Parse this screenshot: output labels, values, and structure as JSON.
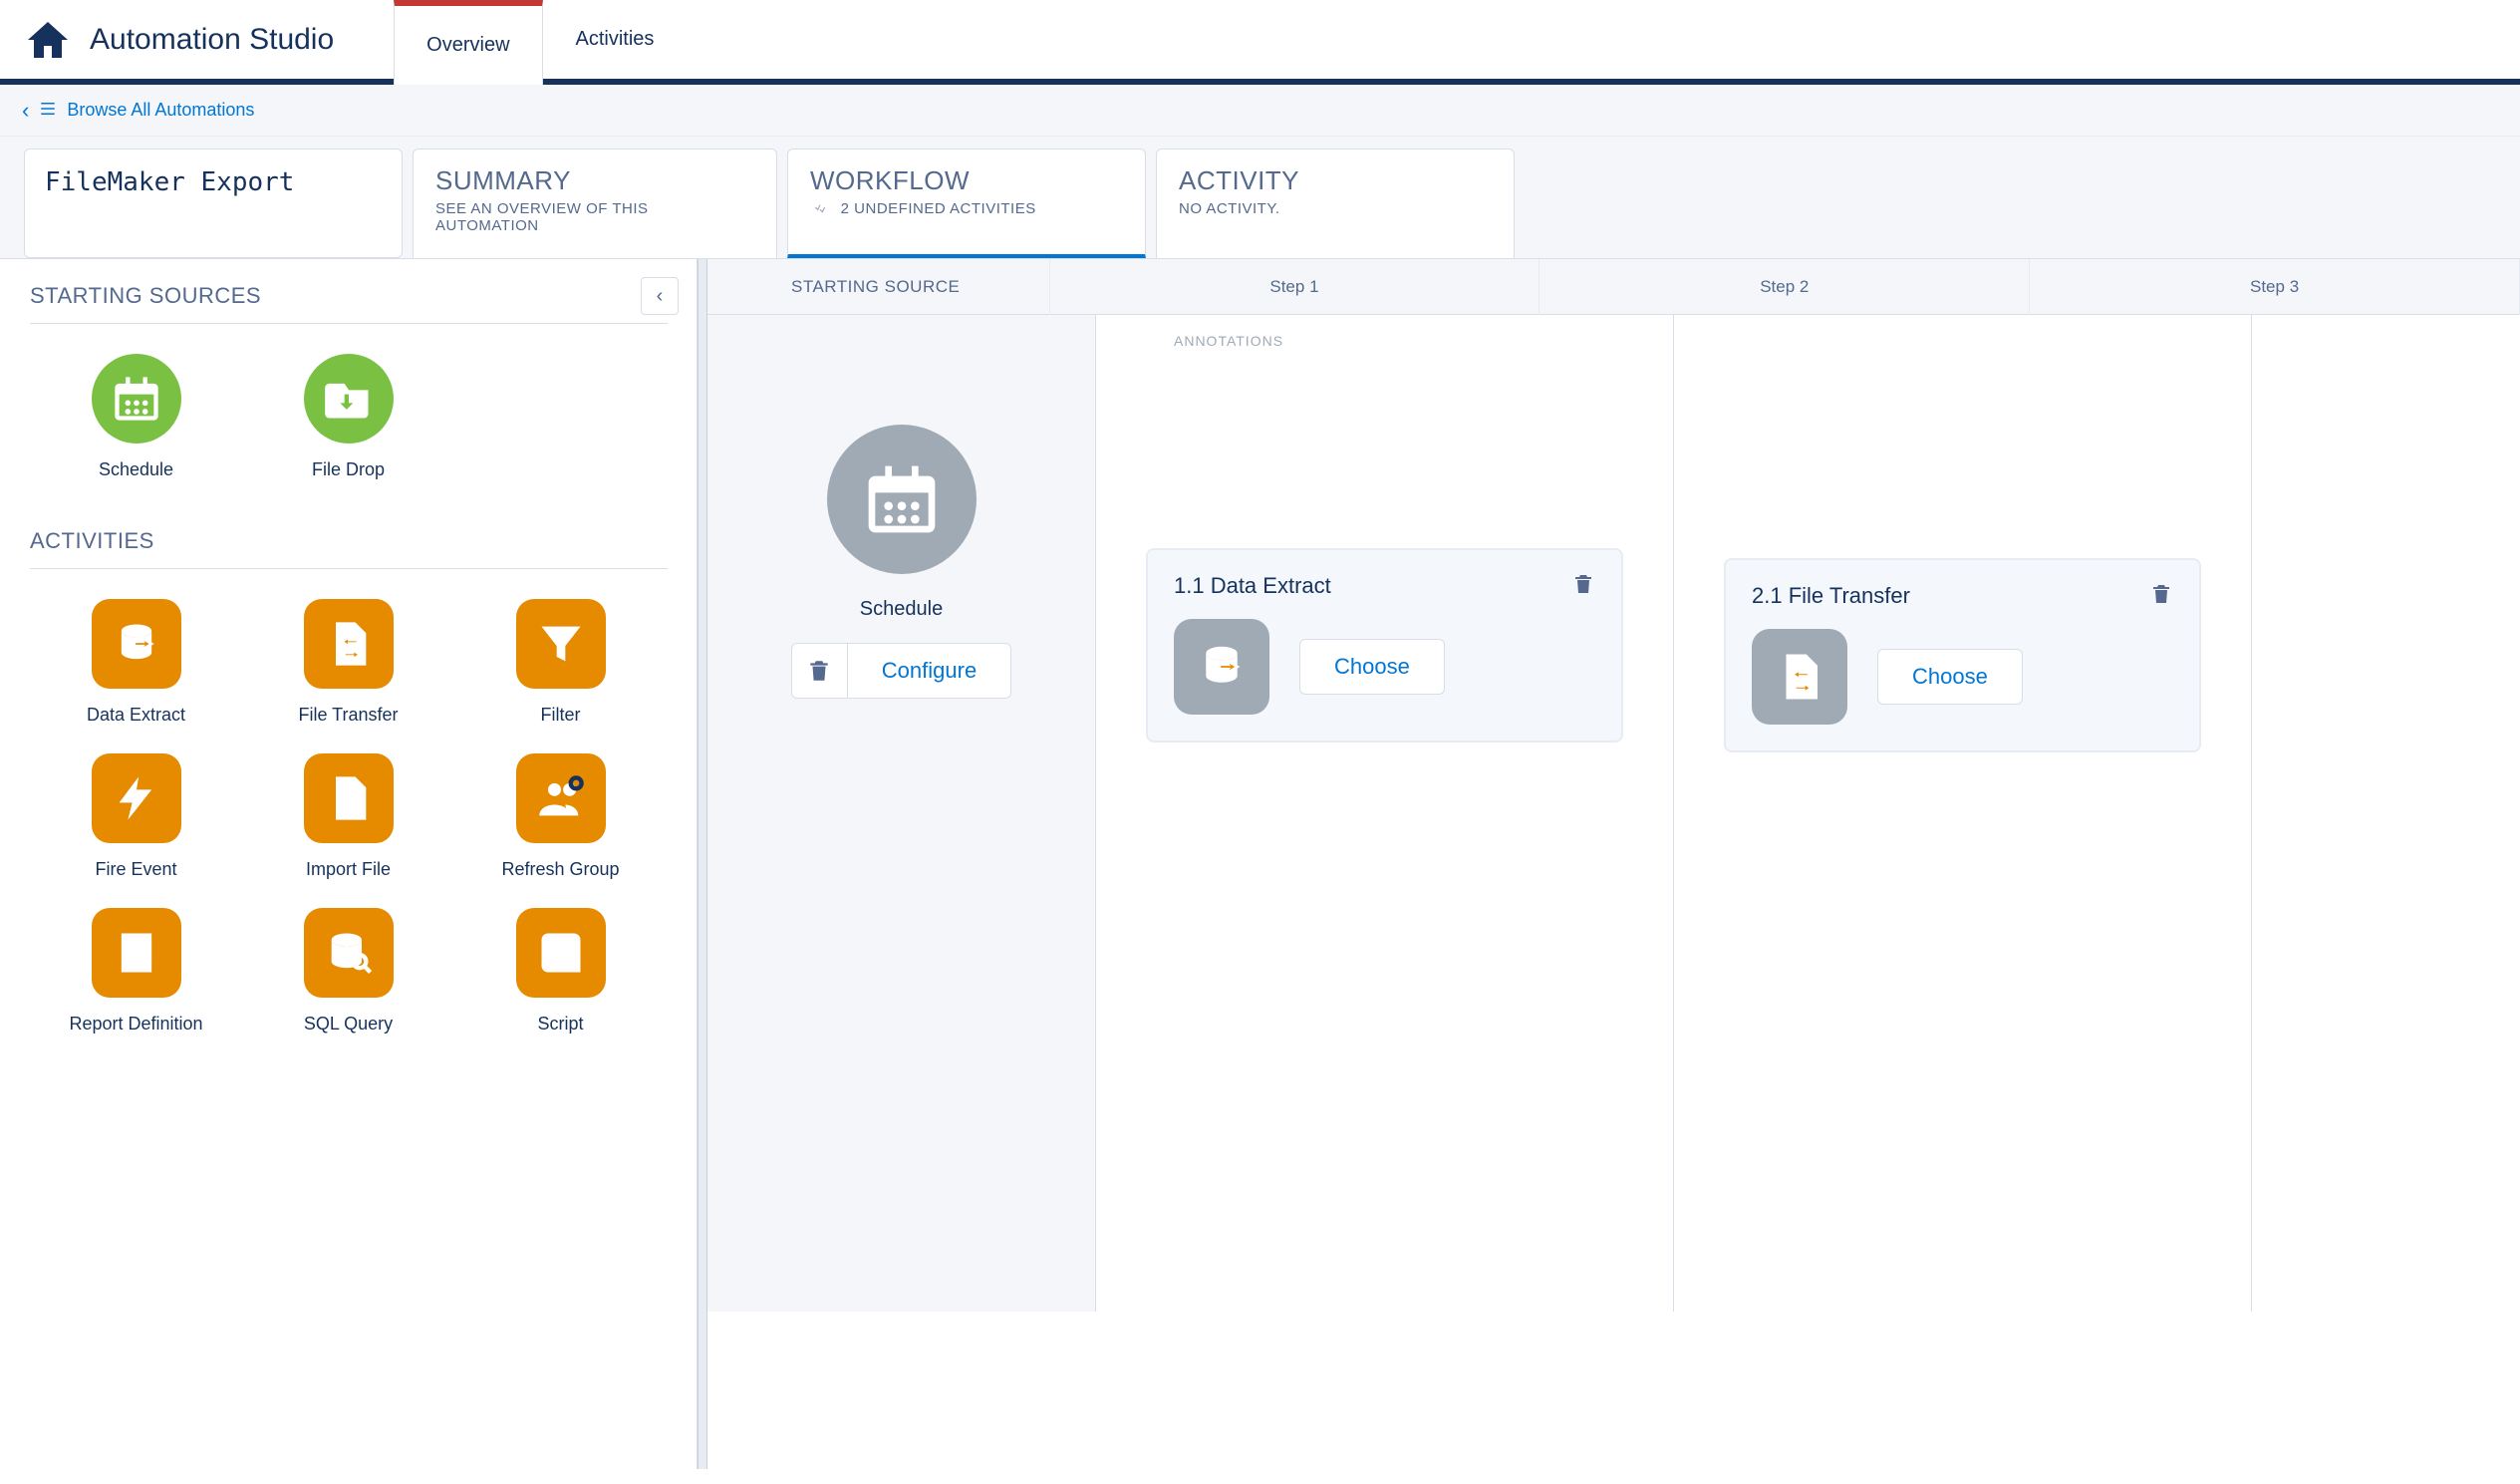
{
  "app_title": "Automation Studio",
  "tabs": {
    "overview": "Overview",
    "activities": "Activities"
  },
  "breadcrumb": {
    "browse_all": "Browse All Automations"
  },
  "automation_name": "FileMaker Export",
  "header_cards": {
    "summary": {
      "title": "SUMMARY",
      "sub": "SEE AN OVERVIEW OF THIS AUTOMATION"
    },
    "workflow": {
      "title": "WORKFLOW",
      "sub": "2 UNDEFINED ACTIVITIES"
    },
    "activity": {
      "title": "ACTIVITY",
      "sub": "NO ACTIVITY."
    }
  },
  "palette": {
    "sources_title": "STARTING SOURCES",
    "activities_title": "ACTIVITIES",
    "sources": {
      "schedule": "Schedule",
      "filedrop": "File Drop"
    },
    "activities": {
      "data_extract": "Data Extract",
      "file_transfer": "File Transfer",
      "filter": "Filter",
      "fire_event": "Fire Event",
      "import_file": "Import File",
      "refresh_group": "Refresh Group",
      "report_definition": "Report Definition",
      "sql_query": "SQL Query",
      "script": "Script"
    }
  },
  "canvas": {
    "starting_source": "STARTING SOURCE",
    "step1": "Step 1",
    "step2": "Step 2",
    "step3": "Step 3",
    "annotations": "ANNOTATIONS",
    "schedule_label": "Schedule",
    "configure": "Configure",
    "choose": "Choose",
    "card1_title": "1.1 Data Extract",
    "card2_title": "2.1 File Transfer"
  }
}
